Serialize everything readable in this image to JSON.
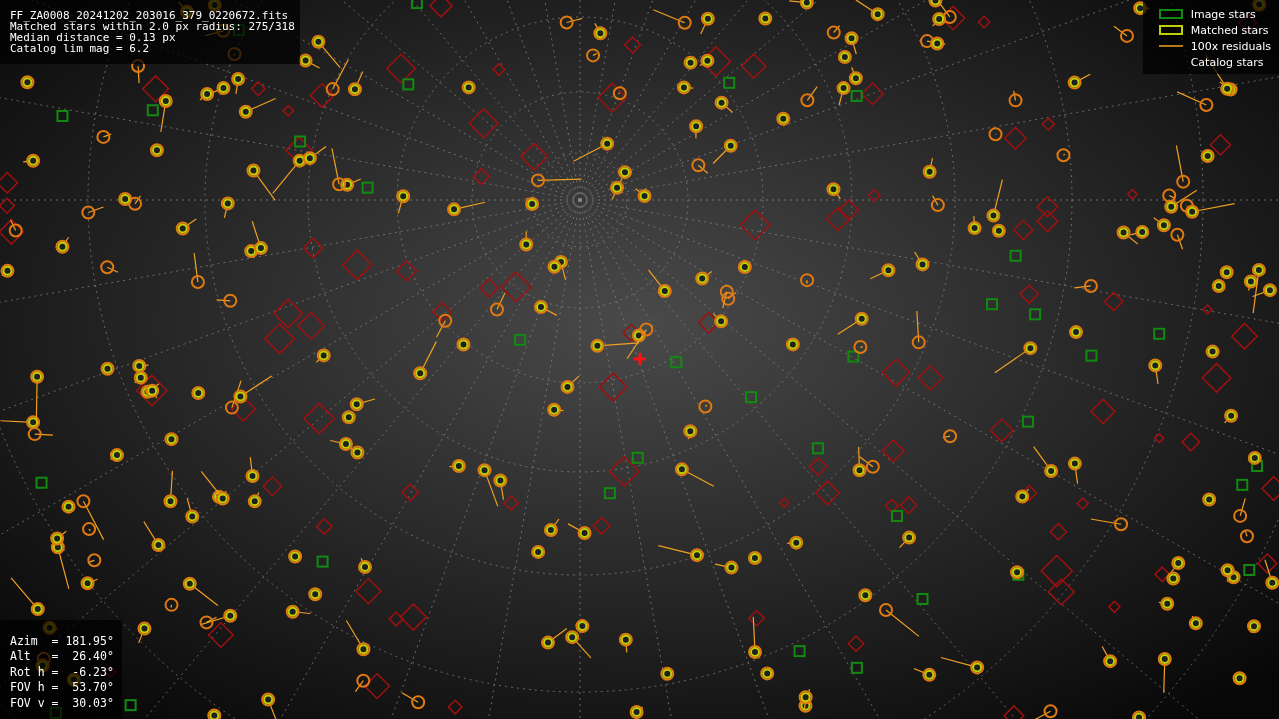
{
  "header": {
    "lines": [
      "FF_ZA0008_20241202_203016_379_0220672.fits",
      "Matched stars within 2.0 px radius: 275/318",
      "Median distance = 0.13 px",
      "Catalog lim mag = 6.2"
    ]
  },
  "legend": {
    "items": [
      {
        "label": "Image stars",
        "kind": "image"
      },
      {
        "label": "Matched stars",
        "kind": "matched"
      },
      {
        "label": "100x residuals",
        "kind": "residual"
      },
      {
        "label": "Catalog stars",
        "kind": "catalog"
      }
    ]
  },
  "pointing": {
    "lines": [
      "Azim  = 181.95°",
      "Alt   =  26.40°",
      "Rot h =  -6.23°",
      "FOV h =  53.70°",
      "FOV v =  30.03°"
    ]
  }
}
